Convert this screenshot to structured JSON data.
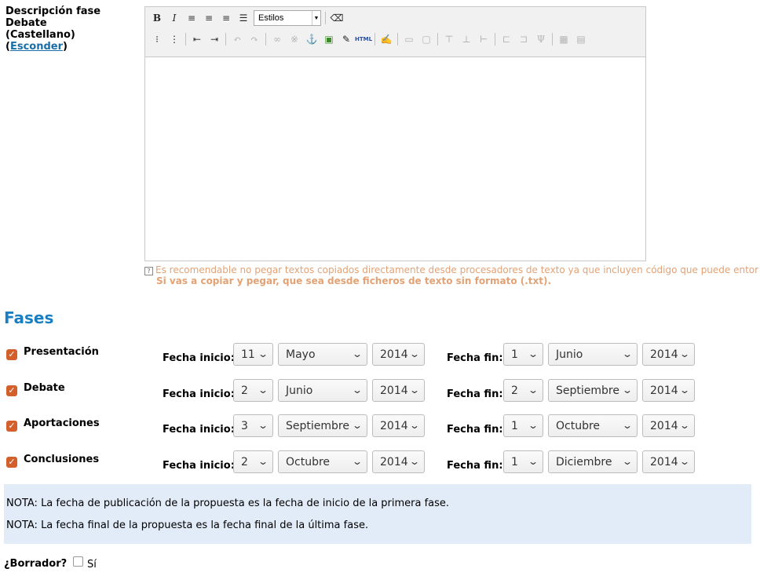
{
  "editor_field": {
    "label_line1": "Descripción fase Debate",
    "label_line2": "(Castellano) (",
    "hide_link": "Esconder",
    "label_close": ")",
    "style_select": "Estilos",
    "toolbar_html_label": "HTML"
  },
  "hint": {
    "line1": "Es recomendable no pegar textos copiados directamente desde procesadores de texto ya que incluyen código que puede entor",
    "line2": "Si vas a copiar y pegar, que sea desde ficheros de texto sin formato (.txt)."
  },
  "fases": {
    "title": "Fases",
    "start_label": "Fecha inicio:",
    "end_label": "Fecha fin:",
    "items": [
      {
        "name": "Presentación",
        "checked": true,
        "start": {
          "day": "11",
          "month": "Mayo",
          "year": "2014"
        },
        "end": {
          "day": "1",
          "month": "Junio",
          "year": "2014"
        }
      },
      {
        "name": "Debate",
        "checked": true,
        "start": {
          "day": "2",
          "month": "Junio",
          "year": "2014"
        },
        "end": {
          "day": "2",
          "month": "Septiembre",
          "year": "2014"
        }
      },
      {
        "name": "Aportaciones",
        "checked": true,
        "start": {
          "day": "3",
          "month": "Septiembre",
          "year": "2014"
        },
        "end": {
          "day": "1",
          "month": "Octubre",
          "year": "2014"
        }
      },
      {
        "name": "Conclusiones",
        "checked": true,
        "start": {
          "day": "2",
          "month": "Octubre",
          "year": "2014"
        },
        "end": {
          "day": "1",
          "month": "Diciembre",
          "year": "2014"
        }
      }
    ]
  },
  "notes": {
    "note1": "NOTA: La fecha de publicación de la propuesta es la fecha de inicio de la primera fase.",
    "note2": "NOTA: La fecha final de la propuesta es la fecha final de la última fase."
  },
  "borrador": {
    "label": "¿Borrador?",
    "option": "Sí",
    "checked": false
  }
}
